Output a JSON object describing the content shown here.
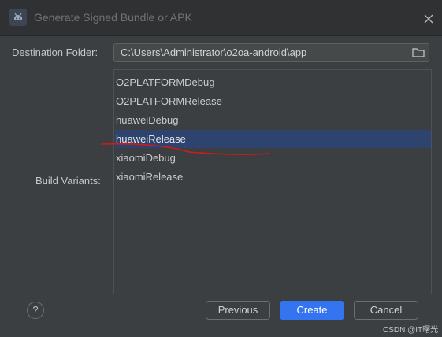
{
  "window": {
    "title": "Generate Signed Bundle or APK",
    "icon": "android-icon"
  },
  "destination": {
    "label": "Destination Folder:",
    "value": "C:\\Users\\Administrator\\o2oa-android\\app",
    "browse_icon": "folder-icon"
  },
  "build_variants": {
    "label": "Build Variants:",
    "items": [
      {
        "label": "O2PLATFORMDebug",
        "selected": false
      },
      {
        "label": "O2PLATFORMRelease",
        "selected": false
      },
      {
        "label": "huaweiDebug",
        "selected": false
      },
      {
        "label": "huaweiRelease",
        "selected": true
      },
      {
        "label": "xiaomiDebug",
        "selected": false
      },
      {
        "label": "xiaomiRelease",
        "selected": false
      }
    ]
  },
  "footer": {
    "help_label": "?",
    "previous_label": "Previous",
    "create_label": "Create",
    "cancel_label": "Cancel"
  },
  "watermark": "CSDN @IT曙光",
  "colors": {
    "accent": "#3574f0",
    "selection": "#2e436e",
    "annotation": "#d11a1a"
  }
}
